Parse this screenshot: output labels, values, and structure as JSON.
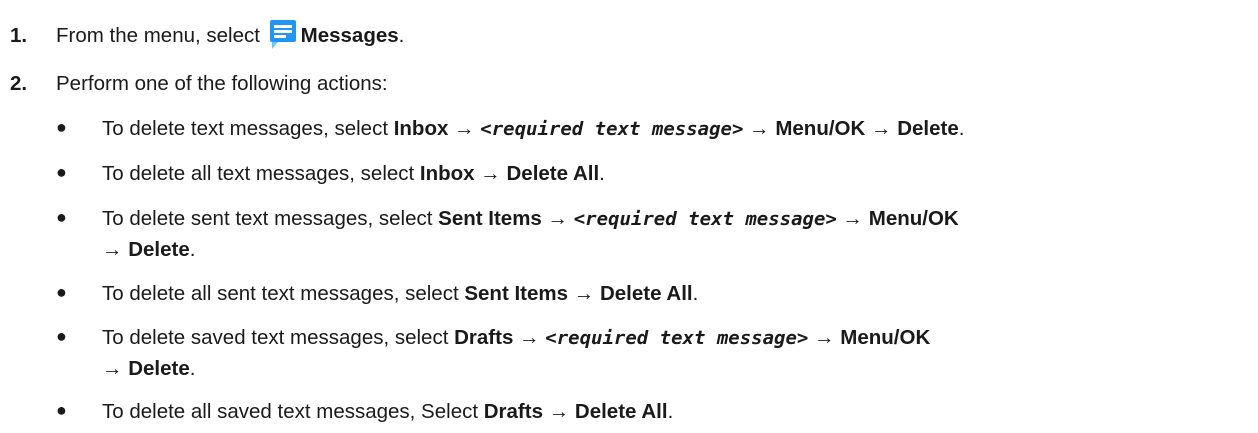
{
  "steps": [
    {
      "number": "1.",
      "prefix": "From the menu, select",
      "icon": "messages-icon",
      "target": "Messages",
      "suffix": "."
    },
    {
      "number": "2.",
      "text": "Perform one of the following actions:"
    }
  ],
  "bullet_glyph": "●",
  "arrow": "→",
  "bullets": [
    {
      "intro": "To delete text messages, select ",
      "path1": "Inbox",
      "placeholder": "<required text message>",
      "path2": "Menu/OK",
      "path3": "Delete",
      "end": "."
    },
    {
      "intro": "To delete all text messages, select ",
      "path1": "Inbox",
      "path2": "Delete All",
      "end": "."
    },
    {
      "intro": "To delete sent text messages, select ",
      "path1": "Sent Items",
      "placeholder": "<required text message>",
      "path2": "Menu/OK",
      "path3": "Delete",
      "end": "."
    },
    {
      "intro": "To delete all sent text messages, select ",
      "path1": "Sent Items",
      "path2": "Delete All",
      "end": "."
    },
    {
      "intro": "To delete saved text messages, select ",
      "path1": "Drafts",
      "placeholder": "<required text message>",
      "path2": "Menu/OK",
      "path3": "Delete",
      "end": "."
    },
    {
      "intro": "To delete all saved text messages, Select ",
      "path1": "Drafts",
      "path2": "Delete All",
      "end": "."
    }
  ],
  "colors": {
    "text": "#1a1a1a",
    "icon_blue": "#2196f3",
    "icon_light": "#6ec6ff"
  }
}
